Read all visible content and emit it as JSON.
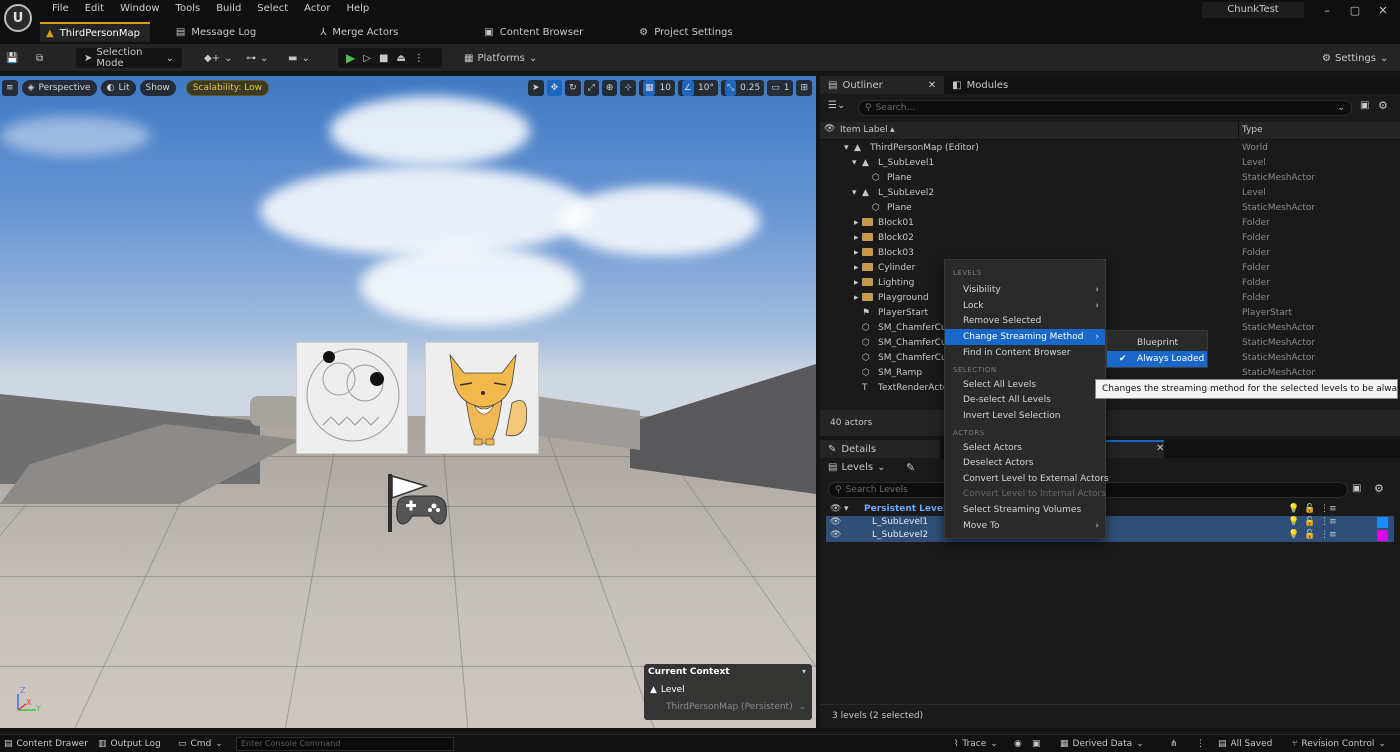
{
  "menu": [
    "File",
    "Edit",
    "Window",
    "Tools",
    "Build",
    "Select",
    "Actor",
    "Help"
  ],
  "project_name": "ChunkTest",
  "window_controls": [
    "–",
    "▢",
    "✕"
  ],
  "tabs": [
    {
      "label": "ThirdPersonMap",
      "icon": "level-icon",
      "active": true
    },
    {
      "label": "Message Log",
      "icon": "log-icon"
    },
    {
      "label": "Merge Actors",
      "icon": "merge-icon"
    },
    {
      "label": "Content Browser",
      "icon": "folder-icon"
    },
    {
      "label": "Project Settings",
      "icon": "gear-icon"
    }
  ],
  "toolbar": {
    "selection_mode": "Selection Mode",
    "platforms": "Platforms",
    "settings": "Settings"
  },
  "viewport": {
    "perspective": "Perspective",
    "lit": "Lit",
    "show": "Show",
    "scalability": "Scalability: Low",
    "grid_snap": "10",
    "rot_snap": "10°",
    "scale_snap": "0.25",
    "camera_speed": "1",
    "context": {
      "title": "Current Context",
      "level_label": "Level",
      "level_value": "ThirdPersonMap (Persistent)"
    },
    "axis_z": "Z",
    "axis_y": "Y",
    "axis_x": "X"
  },
  "outliner": {
    "tab_outliner": "Outliner",
    "tab_modules": "Modules",
    "search_placeholder": "Search...",
    "col_label": "Item Label",
    "col_type": "Type",
    "rows": [
      {
        "label": "ThirdPersonMap (Editor)",
        "type": "World"
      },
      {
        "label": "L_SubLevel1",
        "type": "Level"
      },
      {
        "label": "Plane",
        "type": "StaticMeshActor"
      },
      {
        "label": "L_SubLevel2",
        "type": "Level"
      },
      {
        "label": "Plane",
        "type": "StaticMeshActor"
      },
      {
        "label": "Block01",
        "type": "Folder"
      },
      {
        "label": "Block02",
        "type": "Folder"
      },
      {
        "label": "Block03",
        "type": "Folder"
      },
      {
        "label": "Cylinder",
        "type": "Folder"
      },
      {
        "label": "Lighting",
        "type": "Folder"
      },
      {
        "label": "Playground",
        "type": "Folder"
      },
      {
        "label": "PlayerStart",
        "type": "PlayerStart"
      },
      {
        "label": "SM_ChamferCu",
        "type": "StaticMeshActor"
      },
      {
        "label": "SM_ChamferCu",
        "type": "StaticMeshActor"
      },
      {
        "label": "SM_ChamferCu",
        "type": "StaticMeshActor"
      },
      {
        "label": "SM_Ramp",
        "type": "StaticMeshActor"
      },
      {
        "label": "TextRenderActo",
        "type": ""
      }
    ],
    "actor_count": "40 actors"
  },
  "details": {
    "tab_details": "Details",
    "levels_dropdown": "Levels",
    "search_placeholder": "Search Levels",
    "levels": [
      {
        "name": "Persistent Level",
        "color": ""
      },
      {
        "name": "L_SubLevel1",
        "color": "#1a8cff"
      },
      {
        "name": "L_SubLevel2",
        "color": "#e600e6"
      }
    ],
    "summary": "3 levels (2 selected)"
  },
  "context_menu": {
    "sec_levels": "LEVELS",
    "visibility": "Visibility",
    "lock": "Lock",
    "remove_selected": "Remove Selected",
    "change_streaming": "Change Streaming Method",
    "find_in_cb": "Find in Content Browser",
    "sec_selection": "SELECTION",
    "select_all": "Select All Levels",
    "deselect_all": "De-select All Levels",
    "invert": "Invert Level Selection",
    "sec_actors": "ACTORS",
    "select_actors": "Select Actors",
    "deselect_actors": "Deselect Actors",
    "convert_external": "Convert Level to External Actors",
    "convert_internal": "Convert Level to Internal Actors",
    "select_volumes": "Select Streaming Volumes",
    "move_to": "Move To"
  },
  "submenu": {
    "blueprint": "Blueprint",
    "always_loaded": "Always Loaded"
  },
  "tooltip": "Changes the streaming method for the selected levels to be always loaded",
  "statusbar": {
    "content_drawer": "Content Drawer",
    "output_log": "Output Log",
    "cmd": "Cmd",
    "console_placeholder": "Enter Console Command",
    "trace": "Trace",
    "derived_data": "Derived Data",
    "all_saved": "All Saved",
    "revision_control": "Revision Control"
  },
  "colors": {
    "accent_blue": "#1968c9",
    "tab_gold": "#d5a017",
    "play_green": "#4cbf4c"
  }
}
